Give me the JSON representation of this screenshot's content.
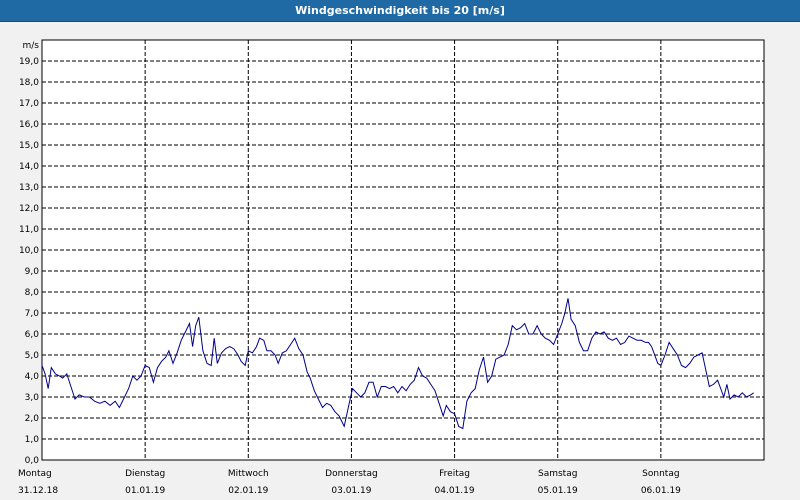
{
  "window": {
    "title": "Windgeschwindigkeit bis 20 [m/s]"
  },
  "colors": {
    "title_bar": "#1f6aa4",
    "series_line": "#00008b",
    "grid": "#000000",
    "background": "#f1f1f1"
  },
  "chart_data": {
    "type": "line",
    "title": "Windgeschwindigkeit bis 20 [m/s]",
    "ylabel": "m/s",
    "xlabel": "",
    "ylim": [
      0,
      20
    ],
    "y_ticks": [
      "0,0",
      "1,0",
      "2,0",
      "3,0",
      "4,0",
      "5,0",
      "6,0",
      "7,0",
      "8,0",
      "9,0",
      "10,0",
      "11,0",
      "12,0",
      "13,0",
      "14,0",
      "15,0",
      "16,0",
      "17,0",
      "18,0",
      "19,0"
    ],
    "grid": true,
    "x_unit": "days since Monday 31.12.18 00:00",
    "xlim": [
      0,
      7
    ],
    "day_labels": [
      {
        "weekday": "Montag",
        "date": "31.12.18"
      },
      {
        "weekday": "Dienstag",
        "date": "01.01.19"
      },
      {
        "weekday": "Mittwoch",
        "date": "02.01.19"
      },
      {
        "weekday": "Donnerstag",
        "date": "03.01.19"
      },
      {
        "weekday": "Freitag",
        "date": "04.01.19"
      },
      {
        "weekday": "Samstag",
        "date": "05.01.19"
      },
      {
        "weekday": "Sonntag",
        "date": "06.01.19"
      }
    ],
    "series": [
      {
        "values": [
          [
            0.0,
            4.5
          ],
          [
            0.03,
            4.1
          ],
          [
            0.06,
            3.4
          ],
          [
            0.09,
            4.4
          ],
          [
            0.13,
            4.1
          ],
          [
            0.17,
            4.0
          ],
          [
            0.2,
            3.9
          ],
          [
            0.24,
            4.1
          ],
          [
            0.28,
            3.5
          ],
          [
            0.32,
            2.9
          ],
          [
            0.36,
            3.1
          ],
          [
            0.41,
            3.0
          ],
          [
            0.46,
            3.0
          ],
          [
            0.51,
            2.8
          ],
          [
            0.56,
            2.7
          ],
          [
            0.61,
            2.8
          ],
          [
            0.66,
            2.6
          ],
          [
            0.71,
            2.8
          ],
          [
            0.75,
            2.5
          ],
          [
            0.79,
            2.9
          ],
          [
            0.84,
            3.4
          ],
          [
            0.88,
            4.0
          ],
          [
            0.92,
            3.8
          ],
          [
            0.96,
            4.0
          ],
          [
            1.0,
            4.5
          ],
          [
            1.04,
            4.4
          ],
          [
            1.08,
            3.7
          ],
          [
            1.12,
            4.4
          ],
          [
            1.16,
            4.7
          ],
          [
            1.2,
            4.9
          ],
          [
            1.23,
            5.2
          ],
          [
            1.27,
            4.6
          ],
          [
            1.31,
            5.1
          ],
          [
            1.35,
            5.7
          ],
          [
            1.39,
            6.1
          ],
          [
            1.43,
            6.5
          ],
          [
            1.46,
            5.4
          ],
          [
            1.49,
            6.4
          ],
          [
            1.52,
            6.8
          ],
          [
            1.56,
            5.2
          ],
          [
            1.6,
            4.6
          ],
          [
            1.64,
            4.5
          ],
          [
            1.67,
            5.8
          ],
          [
            1.7,
            4.6
          ],
          [
            1.74,
            5.1
          ],
          [
            1.78,
            5.3
          ],
          [
            1.82,
            5.4
          ],
          [
            1.86,
            5.3
          ],
          [
            1.9,
            5.0
          ],
          [
            1.93,
            4.7
          ],
          [
            1.97,
            4.5
          ],
          [
            2.0,
            5.2
          ],
          [
            2.04,
            5.1
          ],
          [
            2.08,
            5.4
          ],
          [
            2.11,
            5.8
          ],
          [
            2.15,
            5.7
          ],
          [
            2.18,
            5.2
          ],
          [
            2.22,
            5.2
          ],
          [
            2.26,
            5.0
          ],
          [
            2.29,
            4.6
          ],
          [
            2.33,
            5.1
          ],
          [
            2.37,
            5.2
          ],
          [
            2.41,
            5.5
          ],
          [
            2.45,
            5.8
          ],
          [
            2.49,
            5.3
          ],
          [
            2.53,
            5.0
          ],
          [
            2.57,
            4.2
          ],
          [
            2.6,
            3.9
          ],
          [
            2.64,
            3.3
          ],
          [
            2.68,
            2.9
          ],
          [
            2.72,
            2.5
          ],
          [
            2.76,
            2.7
          ],
          [
            2.8,
            2.6
          ],
          [
            2.84,
            2.3
          ],
          [
            2.88,
            2.1
          ],
          [
            2.93,
            1.6
          ],
          [
            2.97,
            2.5
          ],
          [
            3.01,
            3.4
          ],
          [
            3.05,
            3.2
          ],
          [
            3.09,
            3.0
          ],
          [
            3.13,
            3.2
          ],
          [
            3.17,
            3.7
          ],
          [
            3.21,
            3.7
          ],
          [
            3.25,
            3.0
          ],
          [
            3.29,
            3.5
          ],
          [
            3.33,
            3.5
          ],
          [
            3.37,
            3.4
          ],
          [
            3.41,
            3.5
          ],
          [
            3.45,
            3.2
          ],
          [
            3.49,
            3.5
          ],
          [
            3.53,
            3.3
          ],
          [
            3.57,
            3.6
          ],
          [
            3.61,
            3.8
          ],
          [
            3.65,
            4.4
          ],
          [
            3.69,
            4.0
          ],
          [
            3.73,
            3.9
          ],
          [
            3.77,
            3.6
          ],
          [
            3.81,
            3.3
          ],
          [
            3.85,
            2.7
          ],
          [
            3.89,
            2.1
          ],
          [
            3.92,
            2.6
          ],
          [
            3.96,
            2.3
          ],
          [
            4.0,
            2.2
          ],
          [
            4.04,
            1.6
          ],
          [
            4.08,
            1.5
          ],
          [
            4.12,
            2.8
          ],
          [
            4.16,
            3.2
          ],
          [
            4.2,
            3.4
          ],
          [
            4.24,
            4.3
          ],
          [
            4.28,
            4.9
          ],
          [
            4.32,
            3.7
          ],
          [
            4.36,
            4.0
          ],
          [
            4.4,
            4.8
          ],
          [
            4.44,
            4.9
          ],
          [
            4.48,
            5.0
          ],
          [
            4.52,
            5.5
          ],
          [
            4.56,
            6.4
          ],
          [
            4.6,
            6.2
          ],
          [
            4.64,
            6.3
          ],
          [
            4.68,
            6.5
          ],
          [
            4.72,
            6.0
          ],
          [
            4.76,
            6.0
          ],
          [
            4.8,
            6.4
          ],
          [
            4.84,
            6.0
          ],
          [
            4.88,
            5.8
          ],
          [
            4.92,
            5.7
          ],
          [
            4.96,
            5.5
          ],
          [
            5.0,
            6.0
          ],
          [
            5.04,
            6.5
          ],
          [
            5.07,
            7.0
          ],
          [
            5.1,
            7.7
          ],
          [
            5.13,
            6.7
          ],
          [
            5.17,
            6.4
          ],
          [
            5.21,
            5.6
          ],
          [
            5.25,
            5.2
          ],
          [
            5.29,
            5.2
          ],
          [
            5.33,
            5.8
          ],
          [
            5.37,
            6.1
          ],
          [
            5.41,
            6.0
          ],
          [
            5.45,
            6.1
          ],
          [
            5.49,
            5.8
          ],
          [
            5.53,
            5.7
          ],
          [
            5.57,
            5.8
          ],
          [
            5.61,
            5.5
          ],
          [
            5.65,
            5.6
          ],
          [
            5.69,
            5.9
          ],
          [
            5.73,
            5.8
          ],
          [
            5.77,
            5.7
          ],
          [
            5.81,
            5.7
          ],
          [
            5.85,
            5.6
          ],
          [
            5.88,
            5.6
          ],
          [
            5.91,
            5.4
          ],
          [
            5.94,
            5.0
          ],
          [
            5.97,
            4.6
          ],
          [
            6.0,
            4.5
          ],
          [
            6.04,
            5.0
          ],
          [
            6.08,
            5.6
          ],
          [
            6.12,
            5.3
          ],
          [
            6.16,
            5.0
          ],
          [
            6.2,
            4.5
          ],
          [
            6.24,
            4.4
          ],
          [
            6.28,
            4.6
          ],
          [
            6.32,
            4.9
          ],
          [
            6.36,
            5.0
          ],
          [
            6.4,
            5.1
          ],
          [
            6.44,
            4.2
          ],
          [
            6.47,
            3.5
          ],
          [
            6.51,
            3.6
          ],
          [
            6.55,
            3.8
          ],
          [
            6.58,
            3.4
          ],
          [
            6.61,
            3.0
          ],
          [
            6.64,
            3.6
          ],
          [
            6.67,
            2.9
          ],
          [
            6.71,
            3.1
          ],
          [
            6.75,
            3.0
          ],
          [
            6.79,
            3.2
          ],
          [
            6.83,
            3.0
          ],
          [
            6.87,
            3.1
          ],
          [
            6.9,
            3.2
          ]
        ]
      }
    ]
  }
}
